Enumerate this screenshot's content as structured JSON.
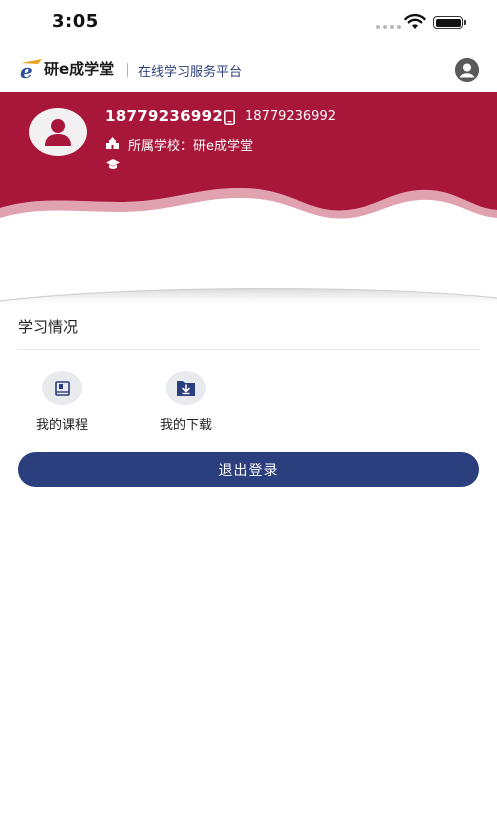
{
  "status_bar": {
    "time": "3:05"
  },
  "header": {
    "logo_text": "研e成学堂",
    "slogan": "在线学习服务平台",
    "profile_icon": "user-circle-icon"
  },
  "user": {
    "name": "18779236992",
    "phone": "18779236992",
    "school_label": "所属学校：研e成学堂"
  },
  "colors": {
    "banner": "#a8173a",
    "primary": "#2b3e7e"
  },
  "study": {
    "title": "学习情况",
    "items": [
      {
        "label": "我的课程",
        "icon": "book-icon"
      },
      {
        "label": "我的下载",
        "icon": "download-icon"
      }
    ]
  },
  "logout_label": "退出登录"
}
